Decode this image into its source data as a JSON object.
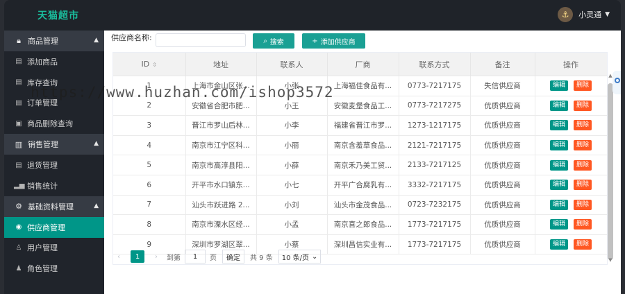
{
  "header": {
    "logo": "天猫超市",
    "username": "小灵通",
    "avatar_icon": "avatar-icon",
    "caret_icon": "caret-down-icon"
  },
  "sidebar": {
    "groups": [
      {
        "label": "商品管理",
        "icon": "lock-icon",
        "items": [
          "添加商品",
          "库存查询",
          "订单管理",
          "商品删除查询"
        ]
      },
      {
        "label": "销售管理",
        "icon": "bookmark-icon",
        "items": [
          "退货管理",
          "销售统计"
        ]
      },
      {
        "label": "基础资料管理",
        "icon": "gear-icon",
        "items": [
          "供应商管理",
          "用户管理",
          "角色管理"
        ]
      }
    ],
    "active_item": "供应商管理"
  },
  "toolbar": {
    "search_label": "供应商名称:",
    "search_value": "",
    "search_button": "搜索",
    "add_button": "添加供应商"
  },
  "table": {
    "columns": [
      "ID",
      "地址",
      "联系人",
      "厂商",
      "联系方式",
      "备注",
      "操作"
    ],
    "rows": [
      {
        "id": "1",
        "address": "上海市金山区张...",
        "contact": "小张",
        "vendor": "上海福佳食品有...",
        "phone": "0773-7217175",
        "note": "失信供应商"
      },
      {
        "id": "2",
        "address": "安徽省合肥市肥...",
        "contact": "小王",
        "vendor": "安徽麦堡食品工...",
        "phone": "0773-7217275",
        "note": "优质供应商"
      },
      {
        "id": "3",
        "address": "晋江市罗山后林...",
        "contact": "小李",
        "vendor": "福建省晋江市罗...",
        "phone": "1273-1217175",
        "note": "优质供应商"
      },
      {
        "id": "4",
        "address": "南京市江宁区科...",
        "contact": "小丽",
        "vendor": "南京含羞草食品...",
        "phone": "2121-7217175",
        "note": "优质供应商"
      },
      {
        "id": "5",
        "address": "南京市高淳县阳...",
        "contact": "小薛",
        "vendor": "南京禾乃美工贸...",
        "phone": "2133-7217125",
        "note": "优质供应商"
      },
      {
        "id": "6",
        "address": "开平市水口镇东...",
        "contact": "小七",
        "vendor": "开平广合腐乳有...",
        "phone": "3332-7217175",
        "note": "优质供应商"
      },
      {
        "id": "7",
        "address": "汕头市跃进路 2...",
        "contact": "小刘",
        "vendor": "汕头市金茂食品...",
        "phone": "0723-7232175",
        "note": "优质供应商"
      },
      {
        "id": "8",
        "address": "南京市溧水区经...",
        "contact": "小孟",
        "vendor": "南京喜之郎食品...",
        "phone": "1773-7217175",
        "note": "优质供应商"
      },
      {
        "id": "9",
        "address": "深圳市罗湖区翠...",
        "contact": "小蔡",
        "vendor": "深圳昌信实业有...",
        "phone": "1773-7217175",
        "note": "优质供应商"
      }
    ],
    "edit_label": "编辑",
    "delete_label": "删除"
  },
  "pagination": {
    "current_page": "1",
    "goto_label": "到第",
    "goto_value": "1",
    "page_unit": "页",
    "confirm": "确定",
    "total": "共 9 条",
    "page_size": "10 条/页"
  },
  "watermark": "https://www.huzhan.com/ishop3572",
  "colors": {
    "accent": "#009688",
    "danger": "#ff5722",
    "logo": "#1abc9c"
  }
}
